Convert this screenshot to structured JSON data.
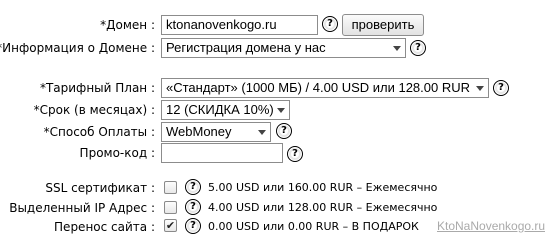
{
  "domain": {
    "label": "*Домен :",
    "value": "ktonanovenkogo.ru",
    "check_button": "проверить",
    "help_glyph": "?"
  },
  "domain_info": {
    "label": "*Информация о Домене :",
    "selected": "Регистрация домена у нас"
  },
  "tariff": {
    "label": "*Тарифный План :",
    "selected": "«Стандарт» (1000 МБ) / 4.00 USD или 128.00 RUR"
  },
  "term": {
    "label": "*Срок (в месяцах) :",
    "selected": "12 (СКИДКА 10%)"
  },
  "payment": {
    "label": "*Способ Оплаты :",
    "selected": "WebMoney"
  },
  "promo": {
    "label": "Промо-код :",
    "value": ""
  },
  "addons": [
    {
      "label": "SSL сертификат :",
      "checked": false,
      "price": "5.00 USD или 160.00 RUR – Ежемесячно"
    },
    {
      "label": "Выделенный IP Адрес :",
      "checked": false,
      "price": "4.00 USD или 128.00 RUR – Ежемесячно"
    },
    {
      "label": "Перенос сайта :",
      "checked": true,
      "price": "0.00 USD или 0.00 RUR – В ПОДАРОК"
    }
  ],
  "watermark": "KtoNaNovenkogo.ru",
  "icons": {
    "help": "question-circle-icon",
    "dropdown": "chevron-down-icon",
    "check": "checkmark-icon"
  }
}
